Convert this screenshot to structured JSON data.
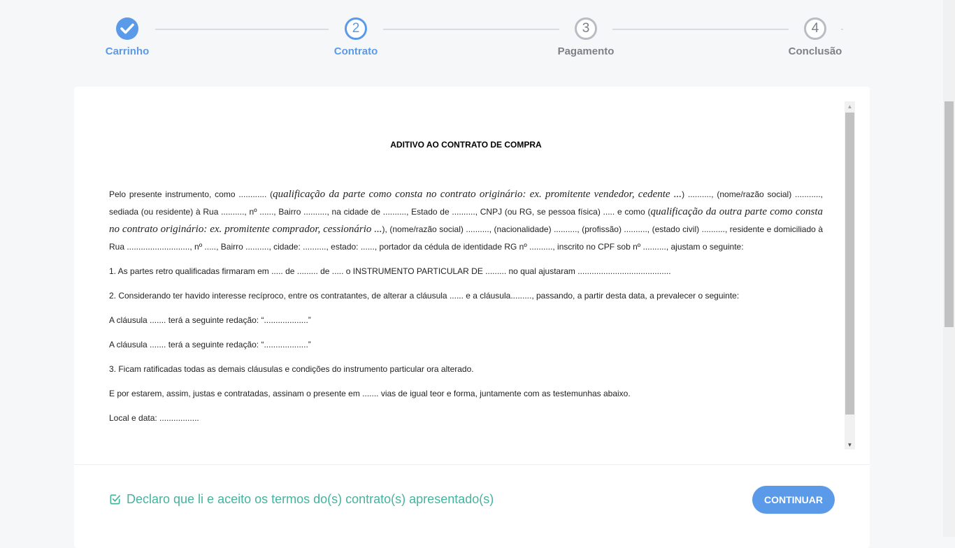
{
  "stepper": {
    "steps": [
      {
        "number": "1",
        "label": "Carrinho",
        "state": "done"
      },
      {
        "number": "2",
        "label": "Contrato",
        "state": "active"
      },
      {
        "number": "3",
        "label": "Pagamento",
        "state": "todo"
      },
      {
        "number": "4",
        "label": "Conclusão",
        "state": "todo"
      }
    ]
  },
  "document": {
    "title": "ADITIVO AO CONTRATO DE COMPRA",
    "p1": {
      "a": "Pelo presente instrumento, como ............ (",
      "b": "qualificação da parte como consta no contrato originário: ex. promitente vendedor, cedente ...",
      "c": ") .........., (nome/razão social) ..........., sediada (ou residente) à Rua .........., nº ......, Bairro .........., na cidade de .........., Estado de .........., CNPJ (ou RG, se pessoa física) ..... e como (",
      "d": "qualificação da outra parte como consta no contrato originário: ex. promitente comprador, cessionário ...",
      "e": "), (nome/razão social) .........., (nacionalidade) .........., (profissão) .........., (estado civil) .........., residente e domiciliado à Rua ..........................., nº ....., Bairro .........., cidade: .........., estado: ......, portador da cédula de identidade RG nº .........., inscrito no CPF sob nº .........., ajustam o seguinte:"
    },
    "p2": "1. As partes retro qualificadas firmaram em ..... de ......... de ..... o INSTRUMENTO PARTICULAR DE ......... no qual ajustaram ........................................",
    "p3": "2. Considerando ter havido interesse recíproco, entre os contratantes, de alterar a cláusula ...... e a cláusula........., passando, a partir desta data, a prevalecer o seguinte:",
    "p4": "A cláusula ....... terá a seguinte redação: “...................”",
    "p5": "A cláusula ....... terá a seguinte redação: “...................”",
    "p6": "3. Ficam ratificadas todas as demais cláusulas e condições do instrumento particular ora alterado.",
    "p7": "E por estarem, assim, justas e contratadas, assinam o presente em ....... vias de igual teor e forma, juntamente com as testemunhas abaixo.",
    "p8": "Local e data: ................."
  },
  "footer": {
    "agree_label": "Declaro que li e aceito os termos do(s) contrato(s) apresentado(s)",
    "continue_label": "CONTINUAR"
  },
  "colors": {
    "accent": "#5b9ae8",
    "agree": "#45b39d",
    "inactive": "#7d8187"
  },
  "icons": {
    "step1": "check-icon",
    "agree": "checkbox-checked-icon"
  }
}
